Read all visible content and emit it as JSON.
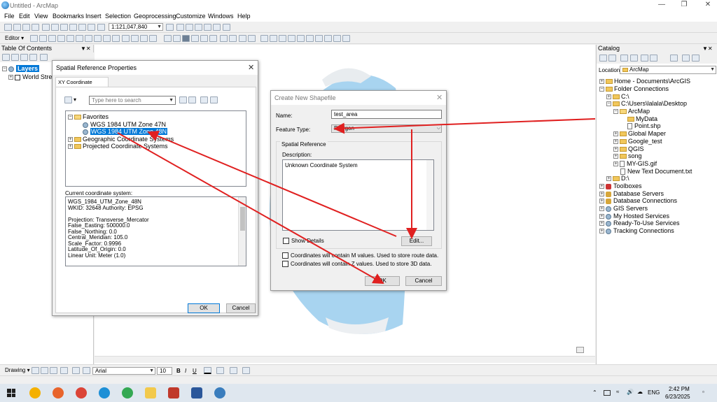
{
  "window": {
    "title": "Untitled - ArcMap"
  },
  "menu": [
    "File",
    "Edit",
    "View",
    "Bookmarks",
    "Insert",
    "Selection",
    "Geoprocessing",
    "Customize",
    "Windows",
    "Help"
  ],
  "toolbar": {
    "scale_value": "1:121,047,840",
    "editor_label": "Editor ▾"
  },
  "toc": {
    "title": "Table Of Contents",
    "layers_label": "Layers",
    "layer_item": "World Street Map"
  },
  "catalog": {
    "title": "Catalog",
    "location_label": "Location:",
    "location_value": "ArcMap",
    "items": [
      "Home - Documents\\ArcGIS",
      "Folder Connections",
      "C:\\",
      "C:\\Users\\lalala\\Desktop",
      "ArcMap",
      "MyData",
      "Point.shp",
      "Global Maper",
      "Google_test",
      "QGIS",
      "song",
      "MY-GIS.gif",
      "New Text Document.txt",
      "D:\\",
      "Toolboxes",
      "Database Servers",
      "Database Connections",
      "GIS Servers",
      "My Hosted Services",
      "Ready-To-Use Services",
      "Tracking Connections"
    ]
  },
  "srp": {
    "title": "Spatial Reference Properties",
    "tab": "XY Coordinate System",
    "search_placeholder": "Type here to search",
    "tree": [
      "Favorites",
      "WGS 1984 UTM Zone 47N",
      "WGS 1984 UTM Zone 48N",
      "Geographic Coordinate Systems",
      "Projected Coordinate Systems"
    ],
    "current_label": "Current coordinate system:",
    "current_lines": [
      "WGS_1984_UTM_Zone_48N",
      "WKID: 32648 Authority: EPSG",
      "",
      "Projection: Transverse_Mercator",
      "False_Easting: 500000.0",
      "False_Northing: 0.0",
      "Central_Meridian: 105.0",
      "Scale_Factor: 0.9996",
      "Latitude_Of_Origin: 0.0",
      "Linear Unit: Meter (1.0)"
    ],
    "ok": "OK",
    "cancel": "Cancel"
  },
  "cns": {
    "title": "Create New Shapefile",
    "name_label": "Name:",
    "name_value": "test_area",
    "feature_label": "Feature Type:",
    "feature_value": "Polygon",
    "sr_group": "Spatial Reference",
    "desc_label": "Description:",
    "desc_value": "Unknown Coordinate System",
    "show_details": "Show Details",
    "edit": "Edit...",
    "m_values": "Coordinates will contain M values. Used to store route data.",
    "z_values": "Coordinates will contain Z values. Used to store 3D data.",
    "ok": "OK",
    "cancel": "Cancel"
  },
  "drawing_bar": {
    "drawing_label": "Drawing ▾",
    "font": "Arial",
    "size": "10",
    "bold": "B",
    "italic": "I",
    "underline": "U"
  },
  "taskbar": {
    "time": "2:42 PM",
    "date": "6/23/2025",
    "lang": "ENG"
  },
  "colors": {
    "arrow": "#e02020",
    "selection": "#0078d7",
    "map_water": "#a8d4f0"
  }
}
